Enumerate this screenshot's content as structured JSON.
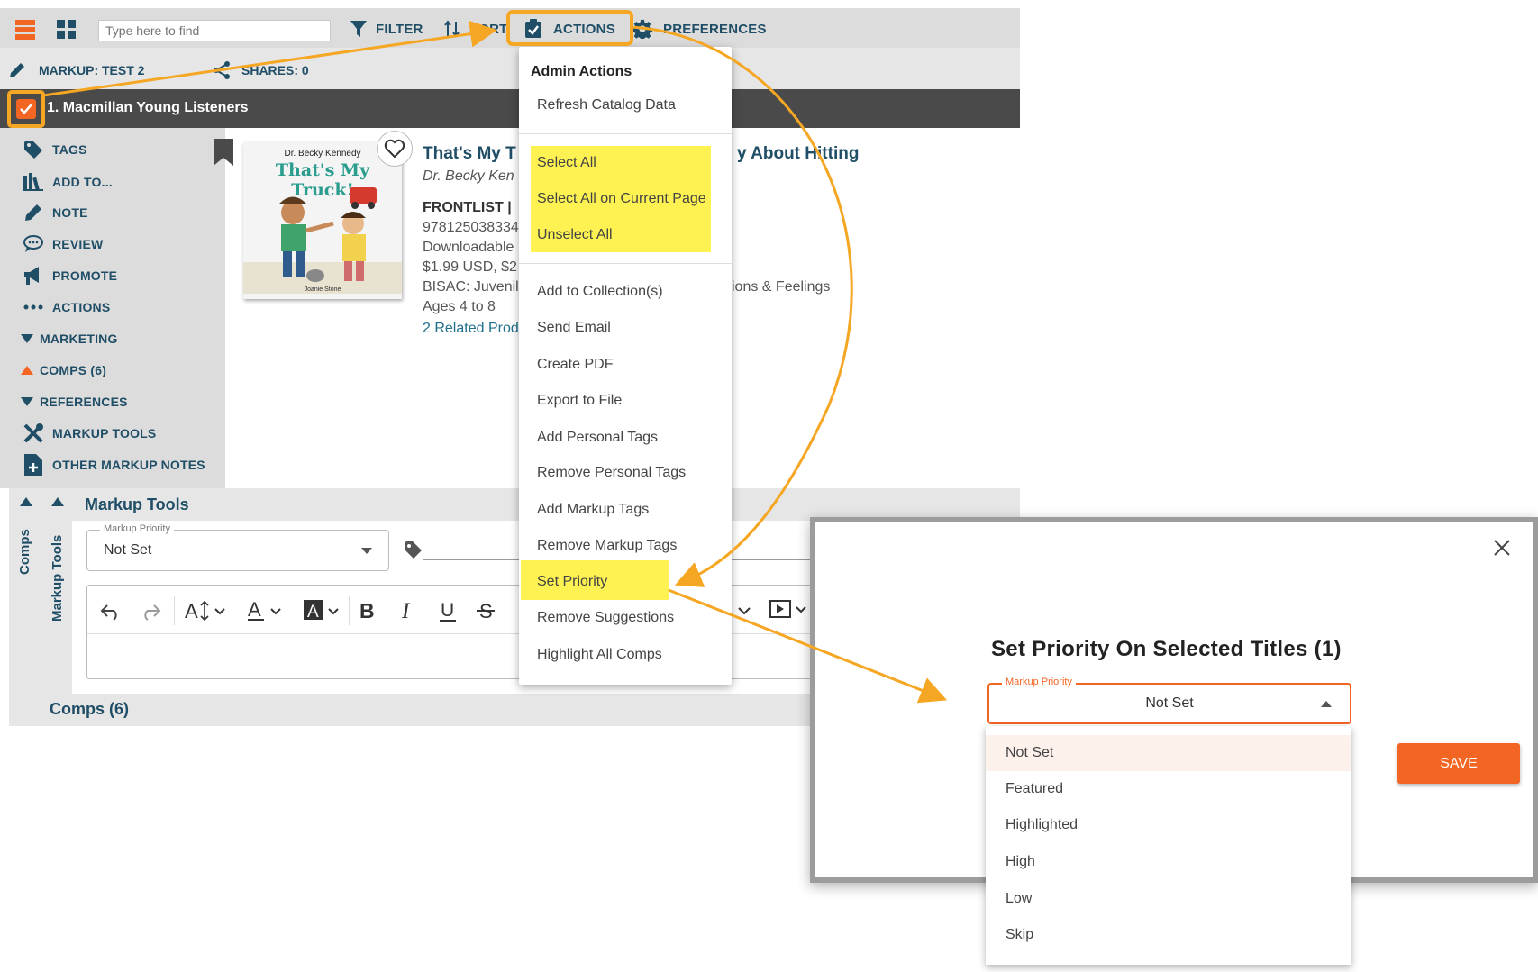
{
  "toolbar": {
    "search_placeholder": "Type here to find",
    "filter_label": "FILTER",
    "sort_label": "SORT",
    "actions_label": "ACTIONS",
    "preferences_label": "PREFERENCES"
  },
  "subbar": {
    "markup_label": "MARKUP: TEST 2",
    "shares_label": "SHARES: 0"
  },
  "title_bar": {
    "title": "1. Macmillan Young Listeners"
  },
  "sidebar": {
    "items": [
      {
        "label": "TAGS",
        "icon": "tag-icon"
      },
      {
        "label": "ADD TO...",
        "icon": "library-icon"
      },
      {
        "label": "NOTE",
        "icon": "pencil-icon"
      },
      {
        "label": "REVIEW",
        "icon": "speech-bubble-icon"
      },
      {
        "label": "PROMOTE",
        "icon": "megaphone-icon"
      },
      {
        "label": "ACTIONS",
        "icon": "more-icon"
      },
      {
        "label": "MARKETING",
        "icon": "caret-down-icon"
      },
      {
        "label": "COMPS (6)",
        "icon": "caret-up-icon"
      },
      {
        "label": "REFERENCES",
        "icon": "caret-down-icon"
      },
      {
        "label": "MARKUP TOOLS",
        "icon": "tools-icon"
      },
      {
        "label": "OTHER MARKUP NOTES",
        "icon": "note-add-icon"
      }
    ]
  },
  "product": {
    "cover_author": "Dr. Becky Kennedy",
    "cover_title": "That's My Truck!",
    "cover_illustrator": "Joanie Stone",
    "title_visible": "That's My T",
    "title_visible_end": "y About Hitting",
    "author": "Dr. Becky Ken",
    "list_label": "FRONTLIST |",
    "isbn": "978125038334",
    "format": "Downloadable",
    "price": "$1.99 USD, $2",
    "bisac": "BISAC: Juvenile",
    "bisac_end": "ions & Feelings",
    "ages": "Ages 4 to 8",
    "related": "2 Related Prod"
  },
  "markup_tools": {
    "heading": "Markup Tools",
    "side_tab_comps": "Comps",
    "side_tab_markup": "Markup Tools",
    "priority_label": "Markup Priority",
    "priority_value": "Not Set",
    "comps_footer": "Comps (6)"
  },
  "actions_menu": {
    "header": "Admin Actions",
    "group1": [
      "Refresh Catalog Data"
    ],
    "group2": [
      "Select All",
      "Select All on Current Page",
      "Unselect All"
    ],
    "group3": [
      "Add to Collection(s)",
      "Send Email",
      "Create PDF",
      "Export to File",
      "Add Personal Tags",
      "Remove Personal Tags",
      "Add Markup Tags",
      "Remove Markup Tags",
      "Set Priority",
      "Remove Suggestions",
      "Highlight All Comps"
    ]
  },
  "dialog": {
    "title": "Set Priority On Selected Titles (1)",
    "select_label": "Markup Priority",
    "select_value": "Not Set",
    "options": [
      "Not Set",
      "Featured",
      "Highlighted",
      "High",
      "Low",
      "Skip"
    ],
    "save_label": "SAVE"
  },
  "colors": {
    "brand_orange": "#f26522",
    "annotation_orange": "#f5a623",
    "highlight_yellow": "#fdf251",
    "teal_text": "#1f4e66",
    "dark_bar": "#4a4a4a"
  }
}
